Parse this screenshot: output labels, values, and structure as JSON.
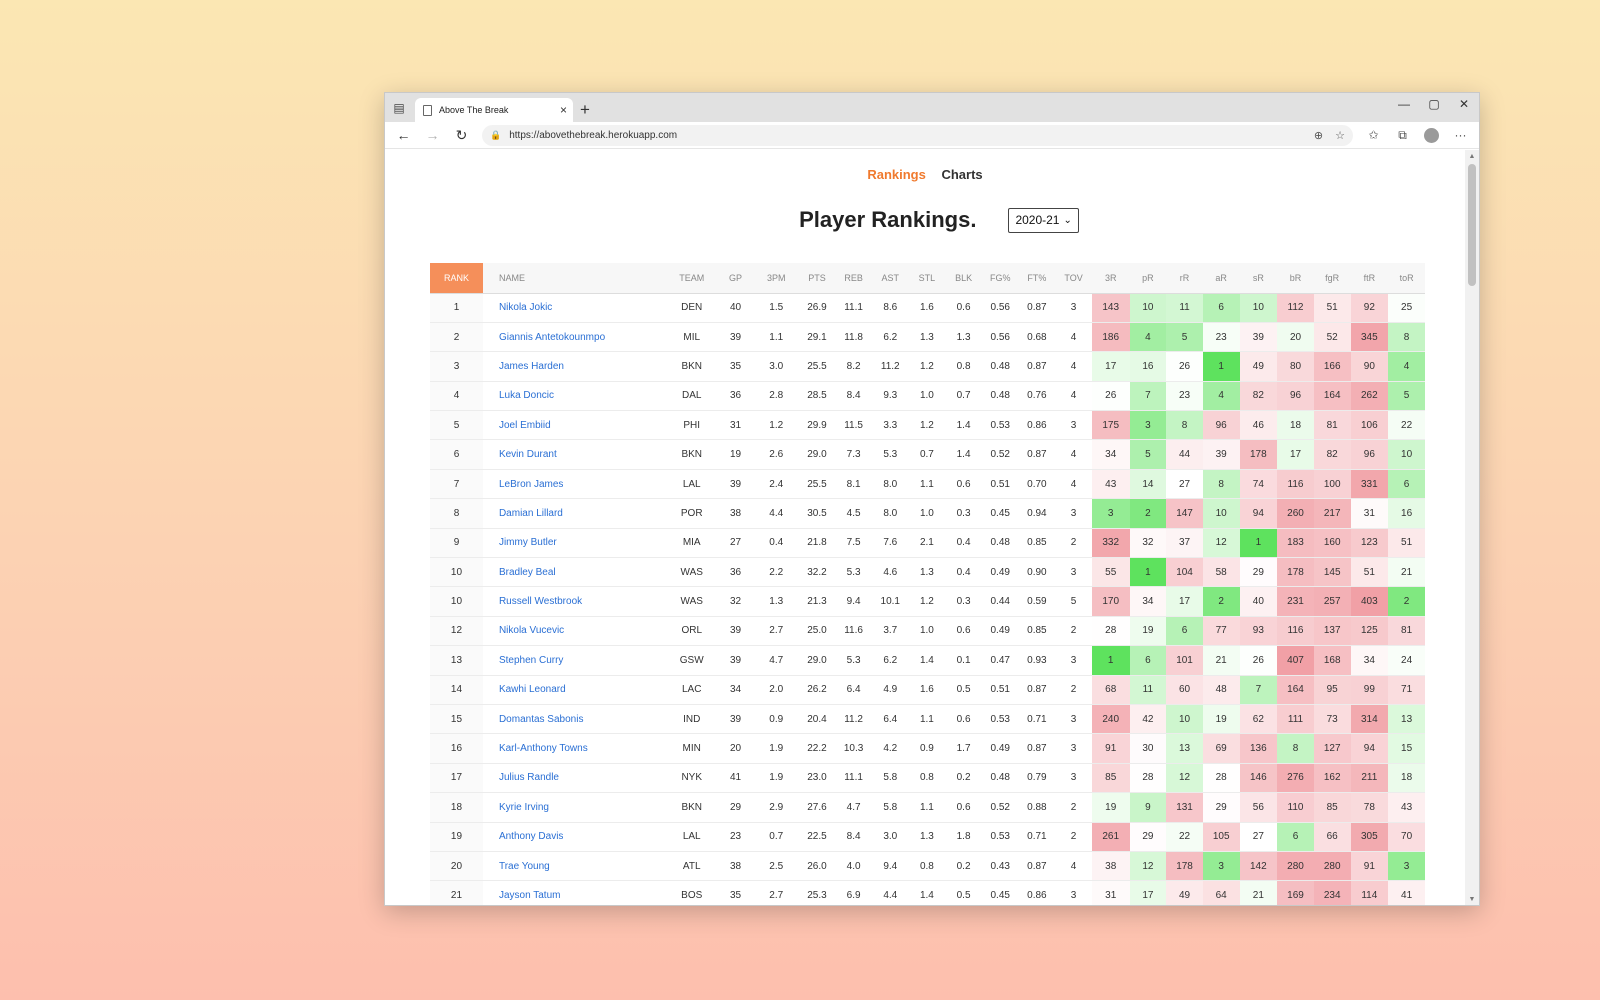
{
  "browser": {
    "tab_title": "Above The Break",
    "url": "https://abovethebreak.herokuapp.com"
  },
  "nav": {
    "rankings": "Rankings",
    "charts": "Charts"
  },
  "page": {
    "title": "Player Rankings.",
    "season": "2020-21"
  },
  "table": {
    "columns": [
      "RANK",
      "NAME",
      "TEAM",
      "GP",
      "3PM",
      "PTS",
      "REB",
      "AST",
      "STL",
      "BLK",
      "FG%",
      "FT%",
      "TOV",
      "3R",
      "pR",
      "rR",
      "aR",
      "sR",
      "bR",
      "fgR",
      "ftR",
      "toR"
    ],
    "rows": [
      [
        "1",
        "Nikola Jokic",
        "DEN",
        "40",
        "1.5",
        "26.9",
        "11.1",
        "8.6",
        "1.6",
        "0.6",
        "0.56",
        "0.87",
        "3",
        "143",
        "10",
        "11",
        "6",
        "10",
        "112",
        "51",
        "92",
        "25"
      ],
      [
        "2",
        "Giannis Antetokounmpo",
        "MIL",
        "39",
        "1.1",
        "29.1",
        "11.8",
        "6.2",
        "1.3",
        "1.3",
        "0.56",
        "0.68",
        "4",
        "186",
        "4",
        "5",
        "23",
        "39",
        "20",
        "52",
        "345",
        "8"
      ],
      [
        "3",
        "James Harden",
        "BKN",
        "35",
        "3.0",
        "25.5",
        "8.2",
        "11.2",
        "1.2",
        "0.8",
        "0.48",
        "0.87",
        "4",
        "17",
        "16",
        "26",
        "1",
        "49",
        "80",
        "166",
        "90",
        "4"
      ],
      [
        "4",
        "Luka Doncic",
        "DAL",
        "36",
        "2.8",
        "28.5",
        "8.4",
        "9.3",
        "1.0",
        "0.7",
        "0.48",
        "0.76",
        "4",
        "26",
        "7",
        "23",
        "4",
        "82",
        "96",
        "164",
        "262",
        "5"
      ],
      [
        "5",
        "Joel Embiid",
        "PHI",
        "31",
        "1.2",
        "29.9",
        "11.5",
        "3.3",
        "1.2",
        "1.4",
        "0.53",
        "0.86",
        "3",
        "175",
        "3",
        "8",
        "96",
        "46",
        "18",
        "81",
        "106",
        "22"
      ],
      [
        "6",
        "Kevin Durant",
        "BKN",
        "19",
        "2.6",
        "29.0",
        "7.3",
        "5.3",
        "0.7",
        "1.4",
        "0.52",
        "0.87",
        "4",
        "34",
        "5",
        "44",
        "39",
        "178",
        "17",
        "82",
        "96",
        "10"
      ],
      [
        "7",
        "LeBron James",
        "LAL",
        "39",
        "2.4",
        "25.5",
        "8.1",
        "8.0",
        "1.1",
        "0.6",
        "0.51",
        "0.70",
        "4",
        "43",
        "14",
        "27",
        "8",
        "74",
        "116",
        "100",
        "331",
        "6"
      ],
      [
        "8",
        "Damian Lillard",
        "POR",
        "38",
        "4.4",
        "30.5",
        "4.5",
        "8.0",
        "1.0",
        "0.3",
        "0.45",
        "0.94",
        "3",
        "3",
        "2",
        "147",
        "10",
        "94",
        "260",
        "217",
        "31",
        "16"
      ],
      [
        "9",
        "Jimmy Butler",
        "MIA",
        "27",
        "0.4",
        "21.8",
        "7.5",
        "7.6",
        "2.1",
        "0.4",
        "0.48",
        "0.85",
        "2",
        "332",
        "32",
        "37",
        "12",
        "1",
        "183",
        "160",
        "123",
        "51"
      ],
      [
        "10",
        "Bradley Beal",
        "WAS",
        "36",
        "2.2",
        "32.2",
        "5.3",
        "4.6",
        "1.3",
        "0.4",
        "0.49",
        "0.90",
        "3",
        "55",
        "1",
        "104",
        "58",
        "29",
        "178",
        "145",
        "51",
        "21"
      ],
      [
        "10",
        "Russell Westbrook",
        "WAS",
        "32",
        "1.3",
        "21.3",
        "9.4",
        "10.1",
        "1.2",
        "0.3",
        "0.44",
        "0.59",
        "5",
        "170",
        "34",
        "17",
        "2",
        "40",
        "231",
        "257",
        "403",
        "2"
      ],
      [
        "12",
        "Nikola Vucevic",
        "ORL",
        "39",
        "2.7",
        "25.0",
        "11.6",
        "3.7",
        "1.0",
        "0.6",
        "0.49",
        "0.85",
        "2",
        "28",
        "19",
        "6",
        "77",
        "93",
        "116",
        "137",
        "125",
        "81"
      ],
      [
        "13",
        "Stephen Curry",
        "GSW",
        "39",
        "4.7",
        "29.0",
        "5.3",
        "6.2",
        "1.4",
        "0.1",
        "0.47",
        "0.93",
        "3",
        "1",
        "6",
        "101",
        "21",
        "26",
        "407",
        "168",
        "34",
        "24"
      ],
      [
        "14",
        "Kawhi Leonard",
        "LAC",
        "34",
        "2.0",
        "26.2",
        "6.4",
        "4.9",
        "1.6",
        "0.5",
        "0.51",
        "0.87",
        "2",
        "68",
        "11",
        "60",
        "48",
        "7",
        "164",
        "95",
        "99",
        "71"
      ],
      [
        "15",
        "Domantas Sabonis",
        "IND",
        "39",
        "0.9",
        "20.4",
        "11.2",
        "6.4",
        "1.1",
        "0.6",
        "0.53",
        "0.71",
        "3",
        "240",
        "42",
        "10",
        "19",
        "62",
        "111",
        "73",
        "314",
        "13"
      ],
      [
        "16",
        "Karl-Anthony Towns",
        "MIN",
        "20",
        "1.9",
        "22.2",
        "10.3",
        "4.2",
        "0.9",
        "1.7",
        "0.49",
        "0.87",
        "3",
        "91",
        "30",
        "13",
        "69",
        "136",
        "8",
        "127",
        "94",
        "15"
      ],
      [
        "17",
        "Julius Randle",
        "NYK",
        "41",
        "1.9",
        "23.0",
        "11.1",
        "5.8",
        "0.8",
        "0.2",
        "0.48",
        "0.79",
        "3",
        "85",
        "28",
        "12",
        "28",
        "146",
        "276",
        "162",
        "211",
        "18"
      ],
      [
        "18",
        "Kyrie Irving",
        "BKN",
        "29",
        "2.9",
        "27.6",
        "4.7",
        "5.8",
        "1.1",
        "0.6",
        "0.52",
        "0.88",
        "2",
        "19",
        "9",
        "131",
        "29",
        "56",
        "110",
        "85",
        "78",
        "43"
      ],
      [
        "19",
        "Anthony Davis",
        "LAL",
        "23",
        "0.7",
        "22.5",
        "8.4",
        "3.0",
        "1.3",
        "1.8",
        "0.53",
        "0.71",
        "2",
        "261",
        "29",
        "22",
        "105",
        "27",
        "6",
        "66",
        "305",
        "70"
      ],
      [
        "20",
        "Trae Young",
        "ATL",
        "38",
        "2.5",
        "26.0",
        "4.0",
        "9.4",
        "0.8",
        "0.2",
        "0.43",
        "0.87",
        "4",
        "38",
        "12",
        "178",
        "3",
        "142",
        "280",
        "280",
        "91",
        "3"
      ],
      [
        "21",
        "Jayson Tatum",
        "BOS",
        "35",
        "2.7",
        "25.3",
        "6.9",
        "4.4",
        "1.4",
        "0.5",
        "0.45",
        "0.86",
        "3",
        "31",
        "17",
        "49",
        "64",
        "21",
        "169",
        "234",
        "114",
        "41"
      ]
    ]
  },
  "colors": {
    "accent": "#f07a2e",
    "rank_header": "#f58f5a",
    "link": "#2a6fd4",
    "good": "#5ee05e",
    "bad": "#f09aa0"
  }
}
